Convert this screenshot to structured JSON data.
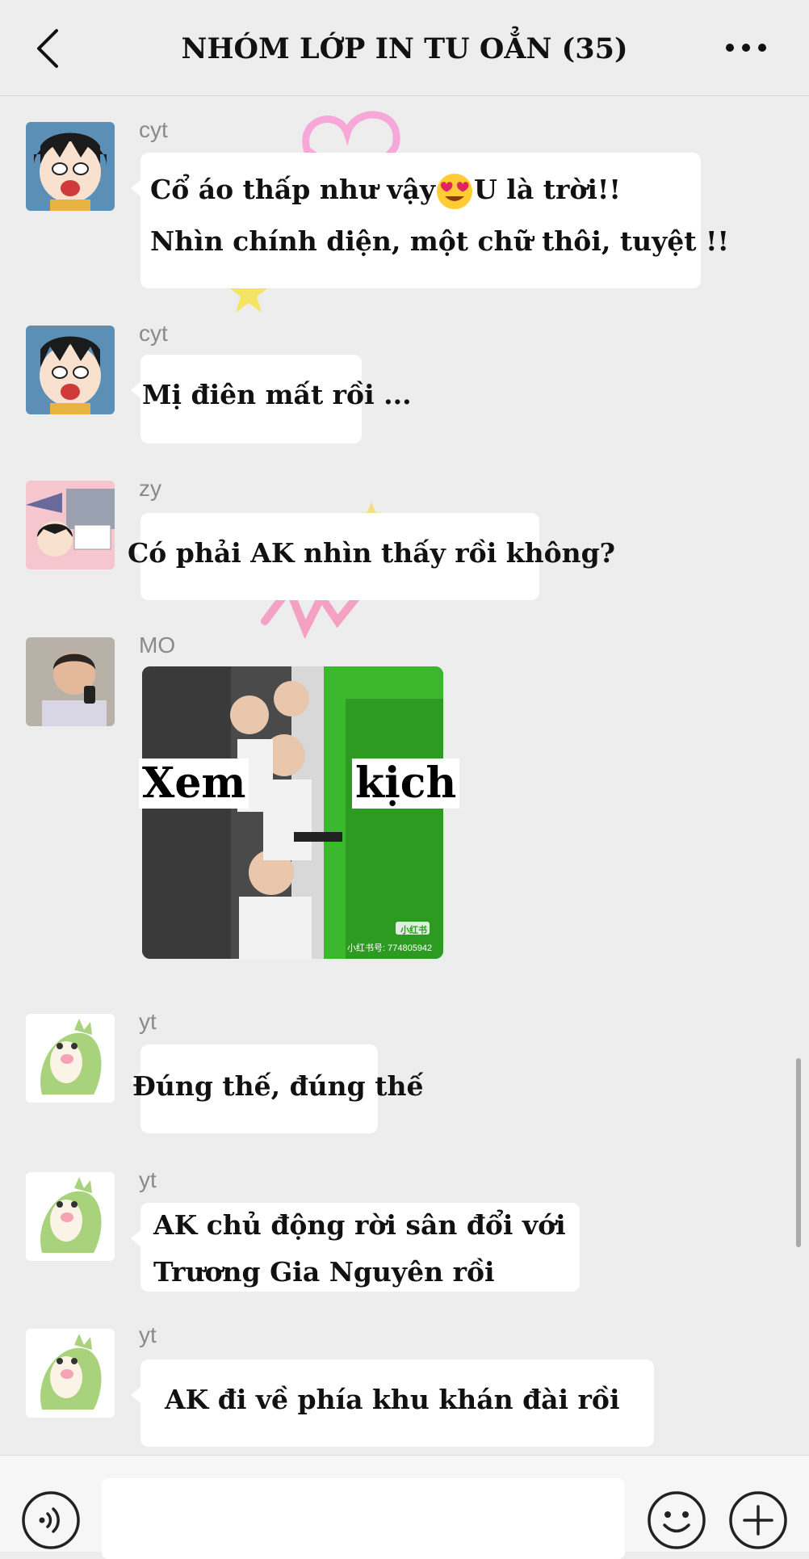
{
  "header": {
    "title": "NHÓM LỚP IN TU OẲN (35)"
  },
  "messages": [
    {
      "sender": "cyt",
      "lines": [
        "Cổ áo thấp như vậy",
        "U là trời!!",
        "Nhìn chính diện, một chữ thôi, tuyệt !!"
      ],
      "emoji": "heart-eyes-emoji"
    },
    {
      "sender": "cyt",
      "lines": [
        "Mị điên mất rồi ..."
      ]
    },
    {
      "sender": "zy",
      "lines": [
        "Có phải AK nhìn thấy rồi không?"
      ]
    },
    {
      "sender": "MO",
      "image_caption_left": "Xem",
      "image_caption_right": "kịch",
      "image_badge": "小红书",
      "image_id_text": "小红书号: 774805942"
    },
    {
      "sender": "yt",
      "lines": [
        "Đúng thế, đúng thế"
      ]
    },
    {
      "sender": "yt",
      "lines": [
        "AK chủ động rời sân đổi với",
        "Trương Gia Nguyên rồi"
      ]
    },
    {
      "sender": "yt",
      "lines": [
        "AK đi về phía khu khán đài rồi"
      ]
    }
  ],
  "input": {
    "value": "",
    "left_icon": "voice-icon",
    "right_icons": [
      "emoji-icon",
      "plus-icon"
    ]
  },
  "colors": {
    "background": "#ededed",
    "bubble": "#ffffff",
    "name_text": "#8a8a8a",
    "green_wall": "#3bb82d"
  }
}
